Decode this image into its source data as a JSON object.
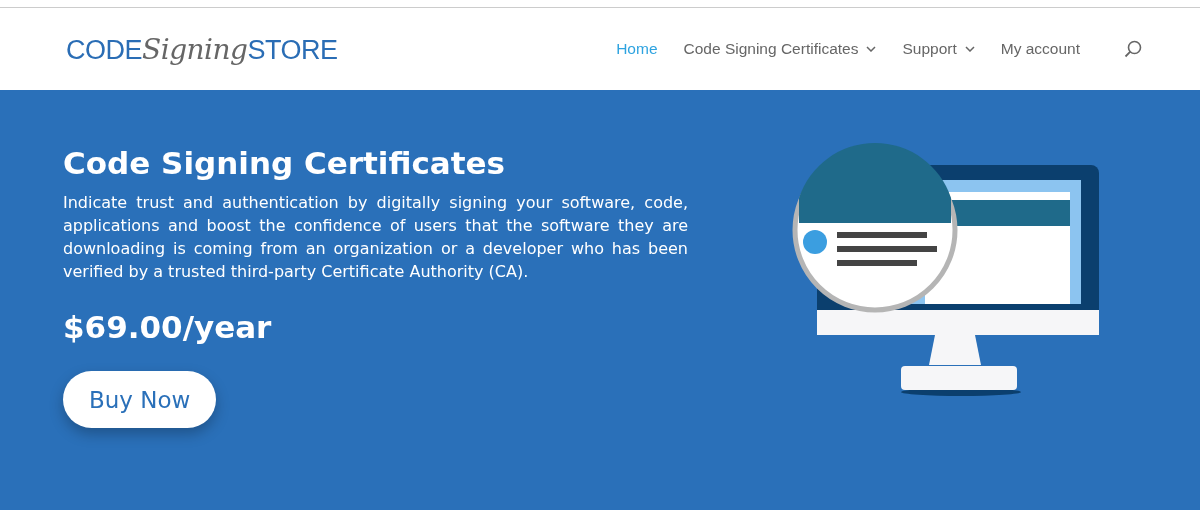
{
  "logo": {
    "first": "CODE",
    "middle": "Signing",
    "last": "STORE"
  },
  "nav": [
    {
      "label": "Home",
      "selected": true,
      "dropdown": false
    },
    {
      "label": "Code Signing Certificates",
      "selected": false,
      "dropdown": true
    },
    {
      "label": "Support",
      "selected": false,
      "dropdown": true
    },
    {
      "label": "My account",
      "selected": false,
      "dropdown": false
    }
  ],
  "hero": {
    "title": "Code Signing Certificates",
    "description": "Indicate trust and authentication by digitally signing your software, code, applications and boost the confidence of users that the software they are downloading is coming from an organization or a developer who has been verified by a trusted third-party Certificate Authority (CA).",
    "price": "$69.00/year",
    "button": "Buy Now"
  }
}
